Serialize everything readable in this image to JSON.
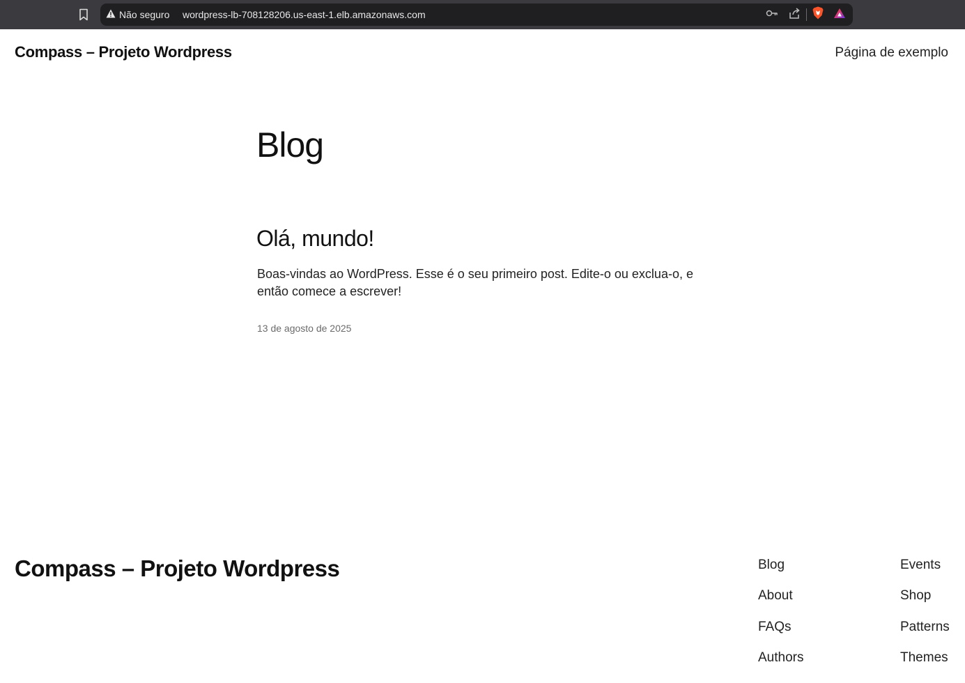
{
  "browser": {
    "security_label": "Não seguro",
    "url": "wordpress-lb-708128206.us-east-1.elb.amazonaws.com",
    "icons": [
      "bookmark-icon",
      "warning-icon",
      "key-icon",
      "share-icon",
      "brave-shield-icon",
      "brave-rewards-icon"
    ]
  },
  "header": {
    "site_title": "Compass – Projeto Wordpress",
    "nav_link": "Página de exemplo"
  },
  "main": {
    "page_heading": "Blog",
    "post": {
      "title": "Olá, mundo!",
      "excerpt": "Boas-vindas ao WordPress. Esse é o seu primeiro post. Edite-o ou exclua-o, e então comece a escrever!",
      "date": "13 de agosto de 2025"
    }
  },
  "footer": {
    "site_title": "Compass – Projeto Wordpress",
    "column1": [
      "Blog",
      "About",
      "FAQs",
      "Authors"
    ],
    "column2": [
      "Events",
      "Shop",
      "Patterns",
      "Themes"
    ]
  }
}
